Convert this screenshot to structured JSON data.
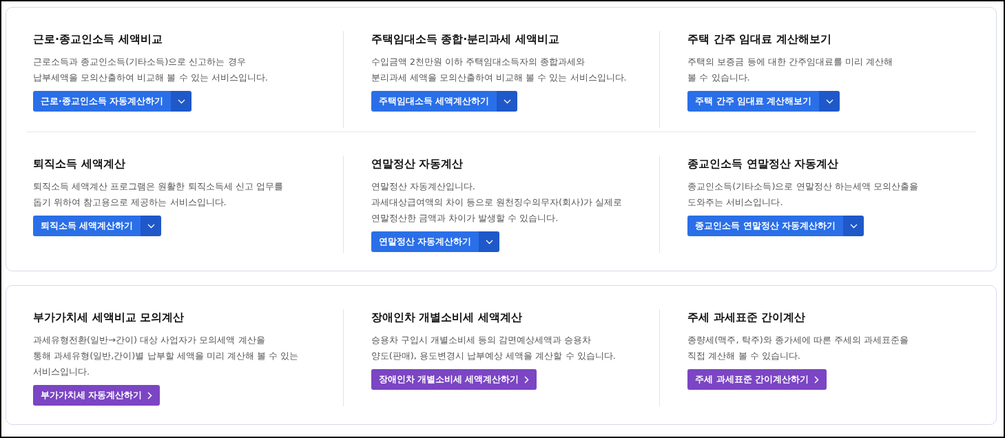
{
  "panels": [
    {
      "rows": [
        [
          {
            "title": "근로·종교인소득 세액비교",
            "description": [
              "근로소득과 종교인소득(기타소득)으로 신고하는 경우",
              "납부세액을 모의산출하여 비교해 볼 수 있는 서비스입니다."
            ],
            "button": {
              "kind": "dropdown",
              "label": "근로·종교인소득 자동계산하기"
            }
          },
          {
            "title": "주택임대소득 종합·분리과세 세액비교",
            "description": [
              "수입금액 2천만원 이하 주택임대소득자의 종합과세와",
              "분리과세 세액을 모의산출하여 비교해 볼 수 있는 서비스입니다."
            ],
            "button": {
              "kind": "dropdown",
              "label": "주택임대소득 세액계산하기"
            }
          },
          {
            "title": "주택 간주 임대료 계산해보기",
            "description": [
              "주택의 보증금 등에 대한 간주임대료를 미리 계산해",
              "볼 수 있습니다."
            ],
            "button": {
              "kind": "dropdown",
              "label": "주택 간주 임대료 계산해보기"
            }
          }
        ],
        [
          {
            "title": "퇴직소득 세액계산",
            "description": [
              "퇴직소득 세액계산 프로그램은 원활한 퇴직소득세 신고 업무를",
              "돕기 위하여 참고용으로 제공하는 서비스입니다."
            ],
            "button": {
              "kind": "dropdown",
              "label": "퇴직소득 세액계산하기"
            }
          },
          {
            "title": "연말정산 자동계산",
            "description": [
              "연말정산 자동계산입니다.",
              "과세대상급여액의 차이 등으로 원천징수의무자(회사)가 실제로",
              "연말정산한 금액과 차이가 발생할 수 있습니다."
            ],
            "button": {
              "kind": "dropdown",
              "label": "연말정산 자동계산하기"
            }
          },
          {
            "title": "종교인소득 연말정산 자동계산",
            "description": [
              "종교인소득(기타소득)으로 연말정산 하는세액 모의산출을",
              "도와주는 서비스입니다."
            ],
            "button": {
              "kind": "dropdown",
              "label": "종교인소득 연말정산 자동계산하기"
            }
          }
        ]
      ]
    },
    {
      "rows": [
        [
          {
            "title": "부가가치세 세액비교 모의계산",
            "description": [
              "과세유형전환(일반→간이) 대상 사업자가 모의세액 계산을",
              "통해 과세유형(일반,간이)별 납부할 세액을 미리 계산해 볼 수 있는",
              "서비스입니다."
            ],
            "button": {
              "kind": "link",
              "label": "부가가치세 자동계산하기"
            }
          },
          {
            "title": "장애인차 개별소비세 세액계산",
            "description": [
              "승용차 구입시 개별소비세 등의 감면예상세액과 승용차",
              "양도(판매), 용도변경시 납부예상 세액을 계산할 수 있습니다."
            ],
            "button": {
              "kind": "link",
              "label": "장애인차 개별소비세 세액계산하기"
            }
          },
          {
            "title": "주세 과세표준 간이계산",
            "description": [
              "종량세(맥주, 탁주)와 종가세에 따른 주세의 과세표준을",
              "직접 계산해 볼 수 있습니다."
            ],
            "button": {
              "kind": "link",
              "label": "주세 과세표준 간이계산하기"
            }
          }
        ]
      ]
    }
  ]
}
